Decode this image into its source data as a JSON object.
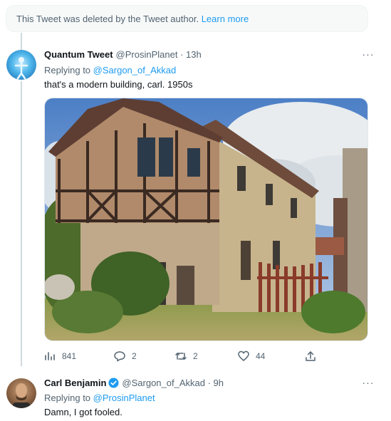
{
  "deleted_notice": {
    "text": "This Tweet was deleted by the Tweet author.",
    "link": "Learn more"
  },
  "tweet1": {
    "name": "Quantum Tweet",
    "handle": "@ProsinPlanet · 13h",
    "replying_prefix": "Replying to ",
    "replying_to": "@Sargon_of_Akkad",
    "text": "that's a modern building, carl. 1950s",
    "photo_subject": "half-timbered stone house",
    "stats": {
      "views": "841",
      "replies": "2",
      "retweets": "2",
      "likes": "44"
    }
  },
  "tweet2": {
    "name": "Carl Benjamin",
    "handle": "@Sargon_of_Akkad · 9h",
    "replying_prefix": "Replying to ",
    "replying_to": "@ProsinPlanet",
    "text": "Damn, I got fooled."
  },
  "more_glyph": "···",
  "colors": {
    "accent": "#1d9bf0",
    "muted": "#536471",
    "text": "#0f1419"
  }
}
